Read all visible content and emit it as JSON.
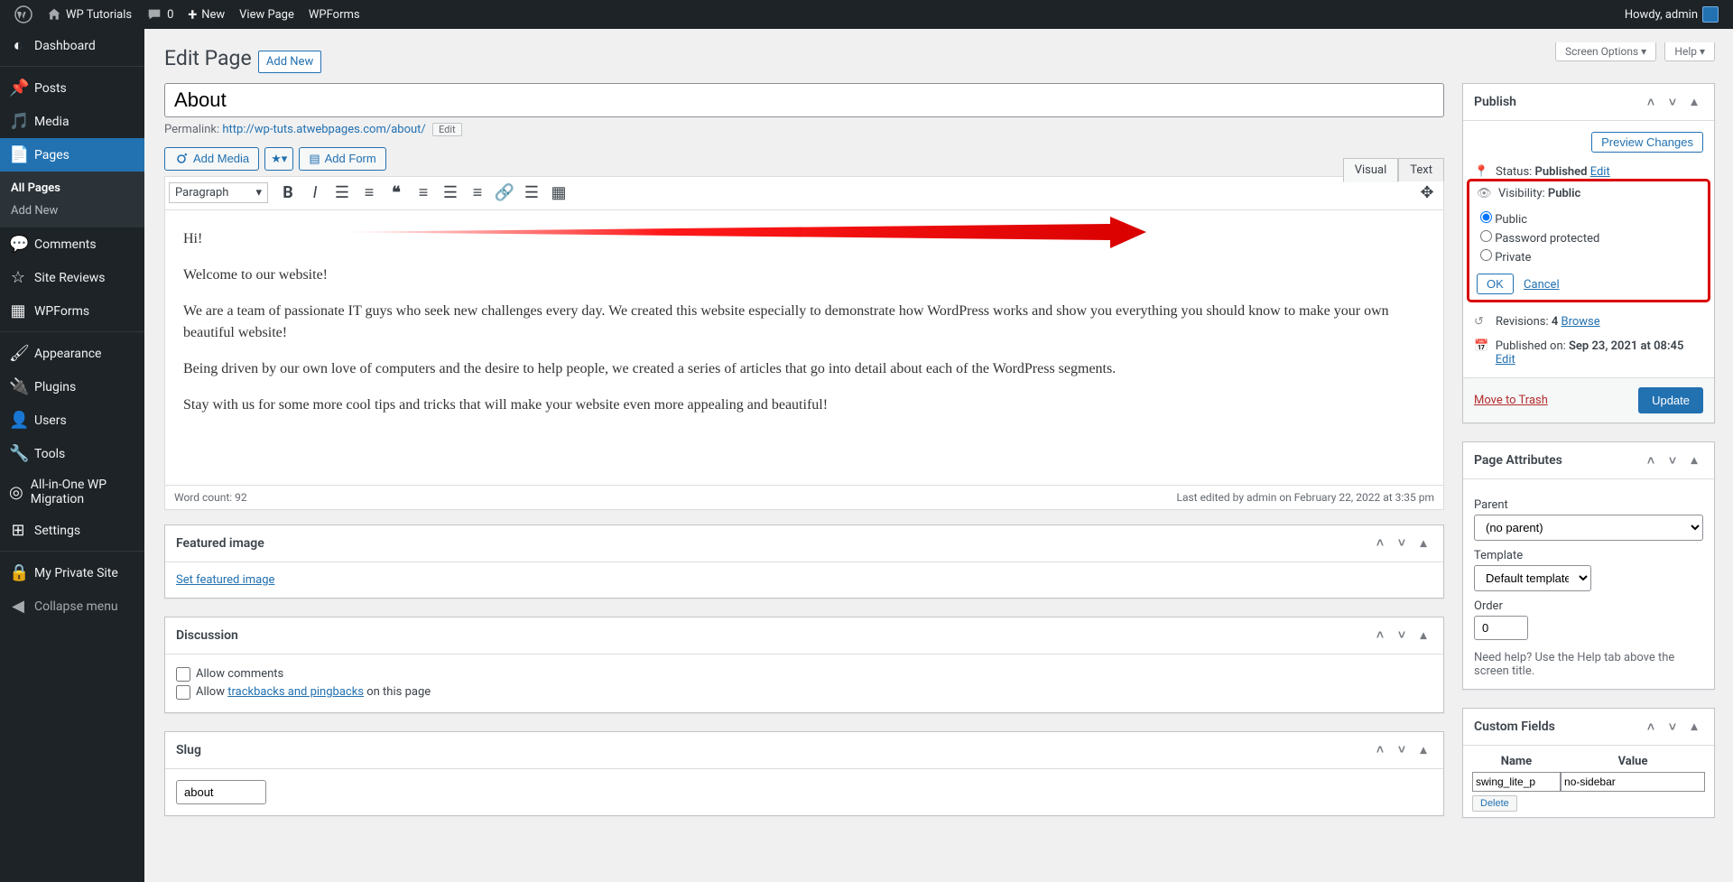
{
  "adminbar": {
    "site_name": "WP Tutorials",
    "comments_count": "0",
    "new_label": "New",
    "view_page": "View Page",
    "wpforms": "WPForms",
    "howdy": "Howdy, admin"
  },
  "menu": {
    "dashboard": "Dashboard",
    "posts": "Posts",
    "media": "Media",
    "pages": "Pages",
    "pages_sub_all": "All Pages",
    "pages_sub_new": "Add New",
    "comments": "Comments",
    "site_reviews": "Site Reviews",
    "wpforms": "WPForms",
    "appearance": "Appearance",
    "plugins": "Plugins",
    "users": "Users",
    "tools": "Tools",
    "aio": "All-in-One WP Migration",
    "settings": "Settings",
    "private_site": "My Private Site",
    "collapse": "Collapse menu"
  },
  "heading": {
    "title_label": "Edit Page",
    "add_new": "Add New",
    "screen_options": "Screen Options ▾",
    "help": "Help ▾"
  },
  "title": "About",
  "permalink": {
    "label": "Permalink: ",
    "url": "http://wp-tuts.atwebpages.com/about/",
    "edit": "Edit"
  },
  "media_buttons": {
    "add_media": "Add Media",
    "add_form": "Add Form"
  },
  "tabs": {
    "visual": "Visual",
    "text": "Text"
  },
  "toolbar": {
    "paragraph": "Paragraph"
  },
  "content": {
    "p1": "Hi!",
    "p2": "Welcome to our website!",
    "p3": "We are a team of passionate IT guys who seek new challenges every day. We created this website especially to demonstrate how WordPress works and show you everything you should know to make your own beautiful website!",
    "p4": "Being driven by our own love of computers and the desire to help people, we created a series of articles that go into detail about each of the WordPress segments.",
    "p5": "Stay with us for some more cool tips and tricks that will make your website even more appealing and beautiful!"
  },
  "status_bar": {
    "word_count": "Word count: 92",
    "last_edited": "Last edited by admin on February 22, 2022 at 3:35 pm"
  },
  "boxes": {
    "featured": {
      "title": "Featured image",
      "link": "Set featured image"
    },
    "discussion": {
      "title": "Discussion",
      "allow_comments": "Allow comments",
      "allow_text_pre": "Allow ",
      "allow_link": "trackbacks and pingbacks",
      "allow_text_post": " on this page"
    },
    "slug": {
      "title": "Slug",
      "value": "about"
    }
  },
  "publish": {
    "title": "Publish",
    "preview": "Preview Changes",
    "status_label": "Status: ",
    "status_value": "Published",
    "status_edit": "Edit",
    "vis_label": "Visibility: ",
    "vis_value": "Public",
    "vis_public": "Public",
    "vis_pw": "Password protected",
    "vis_private": "Private",
    "ok": "OK",
    "cancel": "Cancel",
    "rev_label": "Revisions: ",
    "rev_count": "4",
    "rev_browse": "Browse",
    "pub_label": "Published on: ",
    "pub_date": "Sep 23, 2021 at 08:45",
    "pub_edit": "Edit",
    "trash": "Move to Trash",
    "update": "Update"
  },
  "page_attr": {
    "title": "Page Attributes",
    "parent": "Parent",
    "parent_val": "(no parent)",
    "template": "Template",
    "template_val": "Default template",
    "order": "Order",
    "order_val": "0",
    "help": "Need help? Use the Help tab above the screen title."
  },
  "custom_fields": {
    "title": "Custom Fields",
    "name_h": "Name",
    "value_h": "Value",
    "name_val": "swing_lite_p",
    "value_val": "no-sidebar",
    "delete": "Delete"
  }
}
